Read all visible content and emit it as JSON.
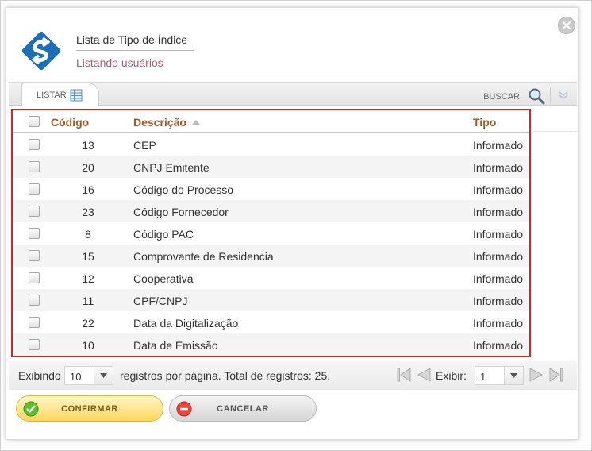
{
  "header": {
    "title": "Lista de Tipo de Índice",
    "subtitle": "Listando usuários"
  },
  "tabs": {
    "listar_label": "LISTAR",
    "buscar_label": "BUSCAR"
  },
  "table": {
    "columns": {
      "code": "Código",
      "description": "Descrição",
      "type": "Tipo"
    },
    "sort_column": "Descrição",
    "sort_direction": "asc",
    "rows": [
      {
        "code": "13",
        "description": "CEP",
        "type": "Informado"
      },
      {
        "code": "20",
        "description": "CNPJ Emitente",
        "type": "Informado"
      },
      {
        "code": "16",
        "description": "Código do Processo",
        "type": "Informado"
      },
      {
        "code": "23",
        "description": "Código Fornecedor",
        "type": "Informado"
      },
      {
        "code": "8",
        "description": "Código PAC",
        "type": "Informado"
      },
      {
        "code": "15",
        "description": "Comprovante de Residencia",
        "type": "Informado"
      },
      {
        "code": "12",
        "description": "Cooperativa",
        "type": "Informado"
      },
      {
        "code": "11",
        "description": "CPF/CNPJ",
        "type": "Informado"
      },
      {
        "code": "22",
        "description": "Data da Digitalização",
        "type": "Informado"
      },
      {
        "code": "10",
        "description": "Data de Emissão",
        "type": "Informado"
      }
    ]
  },
  "pager": {
    "showing_label": "Exibindo",
    "per_page_value": "10",
    "per_page_suffix": "registros por página. Total de registros:",
    "total_records": "25.",
    "page_label": "Exibir:",
    "page_value": "1"
  },
  "actions": {
    "confirm_label": "CONFIRMAR",
    "cancel_label": "CANCELAR"
  },
  "colors": {
    "highlight_border": "#d92222",
    "header_text": "#9a5a2a",
    "subtitle_text": "#b0607a",
    "logo_blue": "#1c6fb5",
    "confirm_bg": "#ffd75e"
  }
}
